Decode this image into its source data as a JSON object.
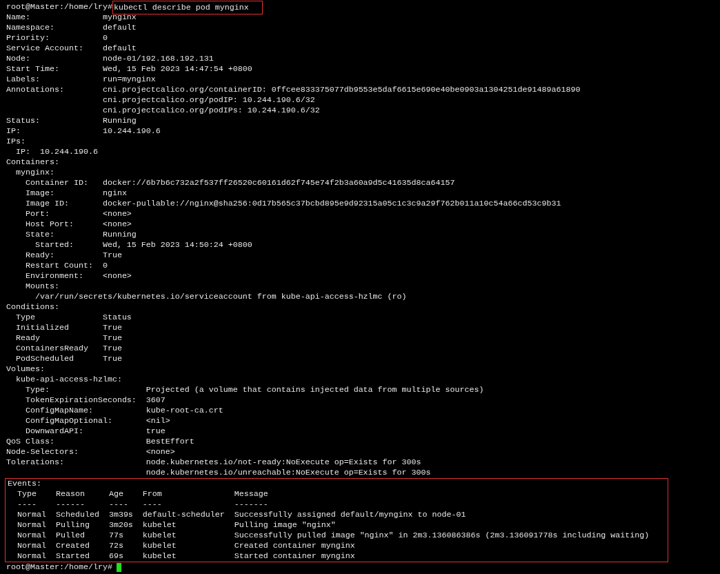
{
  "terminal": {
    "blocks": [
      {
        "kind": "prompt",
        "prompt": "root@Master:/home/lry#",
        "command": "kubectl describe pod mynginx",
        "highlighted": true,
        "cursor": false
      },
      {
        "kind": "output",
        "highlighted": false,
        "lines": [
          "Name:               mynginx",
          "Namespace:          default",
          "Priority:           0",
          "Service Account:    default",
          "Node:               node-01/192.168.192.131",
          "Start Time:         Wed, 15 Feb 2023 14:47:54 +0800",
          "Labels:             run=mynginx",
          "Annotations:        cni.projectcalico.org/containerID: 0ffcee833375077db9553e5daf6615e690e40be0903a1304251de91489a61890",
          "                    cni.projectcalico.org/podIP: 10.244.190.6/32",
          "                    cni.projectcalico.org/podIPs: 10.244.190.6/32",
          "Status:             Running",
          "IP:                 10.244.190.6",
          "IPs:",
          "  IP:  10.244.190.6",
          "Containers:",
          "  mynginx:",
          "    Container ID:   docker://6b7b6c732a2f537ff26520c60161d62f745e74f2b3a60a9d5c41635d8ca64157",
          "    Image:          nginx",
          "    Image ID:       docker-pullable://nginx@sha256:0d17b565c37bcbd895e9d92315a05c1c3c9a29f762b011a10c54a66cd53c9b31",
          "    Port:           <none>",
          "    Host Port:      <none>",
          "    State:          Running",
          "      Started:      Wed, 15 Feb 2023 14:50:24 +0800",
          "    Ready:          True",
          "    Restart Count:  0",
          "    Environment:    <none>",
          "    Mounts:",
          "      /var/run/secrets/kubernetes.io/serviceaccount from kube-api-access-hzlmc (ro)",
          "Conditions:",
          "  Type              Status",
          "  Initialized       True",
          "  Ready             True",
          "  ContainersReady   True",
          "  PodScheduled      True",
          "Volumes:",
          "  kube-api-access-hzlmc:",
          "    Type:                    Projected (a volume that contains injected data from multiple sources)",
          "    TokenExpirationSeconds:  3607",
          "    ConfigMapName:           kube-root-ca.crt",
          "    ConfigMapOptional:       <nil>",
          "    DownwardAPI:             true",
          "QoS Class:                   BestEffort",
          "Node-Selectors:              <none>",
          "Tolerations:                 node.kubernetes.io/not-ready:NoExecute op=Exists for 300s",
          "                             node.kubernetes.io/unreachable:NoExecute op=Exists for 300s"
        ]
      },
      {
        "kind": "output",
        "highlighted": true,
        "lines": [
          "Events:",
          "  Type    Reason     Age    From               Message",
          "  ----    ------     ----   ----               -------",
          "  Normal  Scheduled  3m39s  default-scheduler  Successfully assigned default/mynginx to node-01",
          "  Normal  Pulling    3m20s  kubelet            Pulling image \"nginx\"",
          "  Normal  Pulled     77s    kubelet            Successfully pulled image \"nginx\" in 2m3.136086386s (2m3.136091778s including waiting)",
          "  Normal  Created    72s    kubelet            Created container mynginx",
          "  Normal  Started    69s    kubelet            Started container mynginx"
        ]
      },
      {
        "kind": "prompt",
        "prompt": "root@Master:/home/lry#",
        "highlighted": false,
        "cursor": true
      }
    ]
  }
}
